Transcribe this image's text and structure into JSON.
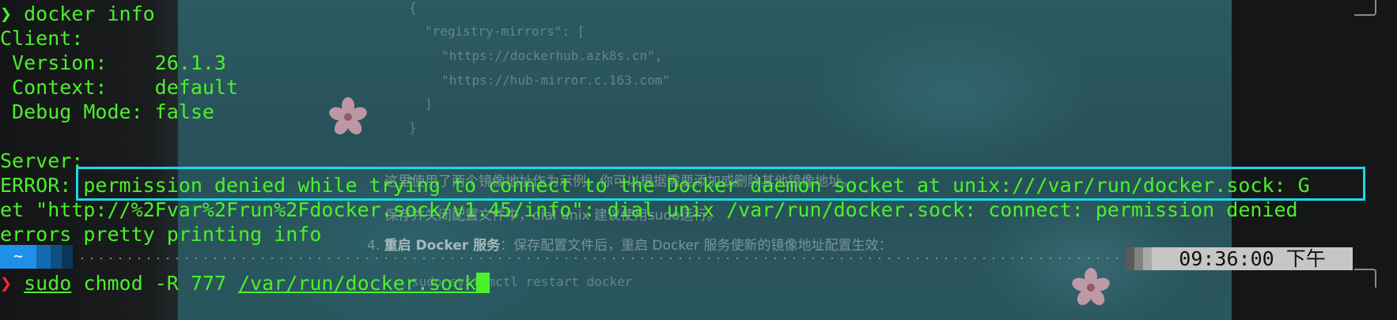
{
  "background_doc": {
    "json_lines": [
      "{",
      "\"registry-mirrors\": [",
      "\"https://dockerhub.azk8s.cn\",",
      "\"https://hub-mirror.c.163.com\"",
      "]",
      "}"
    ],
    "note_line": "这里使用了两个镜像地址作为示例。你可以根据需要添加或删除其他镜像地址。",
    "note_line2": "保存并关闭配置文件中，dial unix 建议使用sudo运行。",
    "step_number": "4.",
    "step_bold": "重启 Docker 服务",
    "step_text": "：保存配置文件后，重启 Docker 服务使新的镜像地址配置生效：",
    "code_line": "sudo systemctl restart docker"
  },
  "terminal": {
    "l1_arrow": "❯",
    "l1_cmd": " docker info",
    "l2": "Client:",
    "l3": " Version:    26.1.3",
    "l4": " Context:    default",
    "l5": " Debug Mode: false",
    "l6": "",
    "l7": "Server:",
    "l8": "ERROR: permission denied while trying to connect to the Docker daemon socket at unix:///var/run/docker.sock: G",
    "l9": "et \"http://%2Fvar%2Frun%2Fdocker.sock/v1.45/info\": dial unix /var/run/docker.sock: connect: permission denied",
    "l10": "errors pretty printing info",
    "prompt_dir": "~",
    "time": "09:36:00 下午",
    "l12_arrow": "❯",
    "l12_sudo": "sudo",
    "l12_cmd": " chmod -R 777 ",
    "l12_path": "/var/run/docker.sock"
  },
  "colors": {
    "terminal_text": "#4af12b",
    "error_arrow": "#ff2a2a",
    "highlight_box": "#19d9e8",
    "prompt_dir_bg": "#1e90e8",
    "time_bg": "#c6c6c6"
  }
}
